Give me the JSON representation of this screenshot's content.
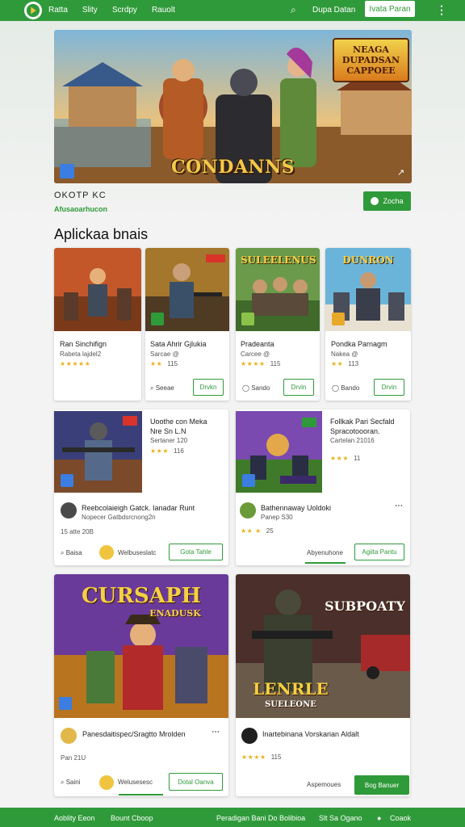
{
  "header": {
    "nav": [
      "Ratta",
      "Slity",
      "Scrdpy",
      "Rauolt"
    ],
    "link": "Dupa Datan",
    "button": "Ivata Paran"
  },
  "hero": {
    "title": "CONDANNS",
    "logo_lines": [
      "NEAGA",
      "DUPADSAN",
      "CAPPOEE"
    ],
    "name": "OKOTP   KC",
    "subtitle": "Afusaoarhucon",
    "button": "Zocha"
  },
  "section": {
    "title": "Aplickaa bnais"
  },
  "row1": [
    {
      "banner": "",
      "name": "Ran Sinchifign",
      "meta": "Rabeta lajdel2",
      "rating": "★★★★★",
      "count": "",
      "link": "Seeae",
      "button": "Drvkn",
      "badge": "#3b7de0"
    },
    {
      "banner": "",
      "name": "Sata Ahrir Gjlukia",
      "meta": "Sarcae @",
      "rating": "★★",
      "count": "115",
      "link": "",
      "button": "",
      "badge": "#2f9a3a"
    },
    {
      "banner": "SULEELENUS",
      "name": "Pradeanta",
      "meta": "Carcee @",
      "rating": "★★★★",
      "count": "115",
      "link": "Sando",
      "button": "Drvin",
      "badge": "#8bc34a"
    },
    {
      "banner": "DUNRON",
      "name": "Pondka Parnagm",
      "meta": "Nakea @",
      "rating": "★★",
      "count": "113",
      "link": "Bando",
      "button": "Drvin",
      "badge": "#e8a92a"
    }
  ],
  "row2": [
    {
      "title_lines": [
        "Uoothe con Meka",
        "Nre Sn L.N",
        "Sertaner 120"
      ],
      "rating": "★★★",
      "count": "116",
      "app_name": "Reebcolaieigh Gatck. Ianadar Runt",
      "app_meta": "Nopecer Gatbdsrcnong2n",
      "small_count": "15 atte  20B",
      "link": "Baisa",
      "mid": "Welbuseslatc",
      "button": "Gota Tahle"
    },
    {
      "title_lines": [
        "Follkak Pari Secfald",
        "Spracotoooran.",
        "Cartelan 21016"
      ],
      "rating": "★★★",
      "count": "11",
      "app_name": "Bathennaway Uoldoki",
      "app_meta": "Panep S30",
      "small_count": "25",
      "link": "Abyenuhone",
      "mid": "",
      "button": "Agiita Pantu"
    }
  ],
  "row3": [
    {
      "banner": "CURSAPH",
      "banner_sub": "ENADUSK",
      "app_name": "Panesdaitispec/Sragtto Mrolden",
      "small_count": "Pan  21U",
      "link": "Saini",
      "mid": "Welusesesc",
      "button": "Dotal Oanva"
    },
    {
      "banner": "SUBPOATY",
      "banner_sub": "LENRLE",
      "banner_sub2": "SUELEONE",
      "app_name": "Inartebinana Vorskarian Aldalt",
      "rating": "★★★★",
      "count": "115",
      "link": "Aspemoues",
      "button": "Bog Banuer"
    }
  ],
  "footer": [
    "Aoblity Eeon",
    "Bount Cboop",
    "Peradigan Bani Do Bolibioa",
    "Slt Sa Ogano",
    "Coaok"
  ]
}
